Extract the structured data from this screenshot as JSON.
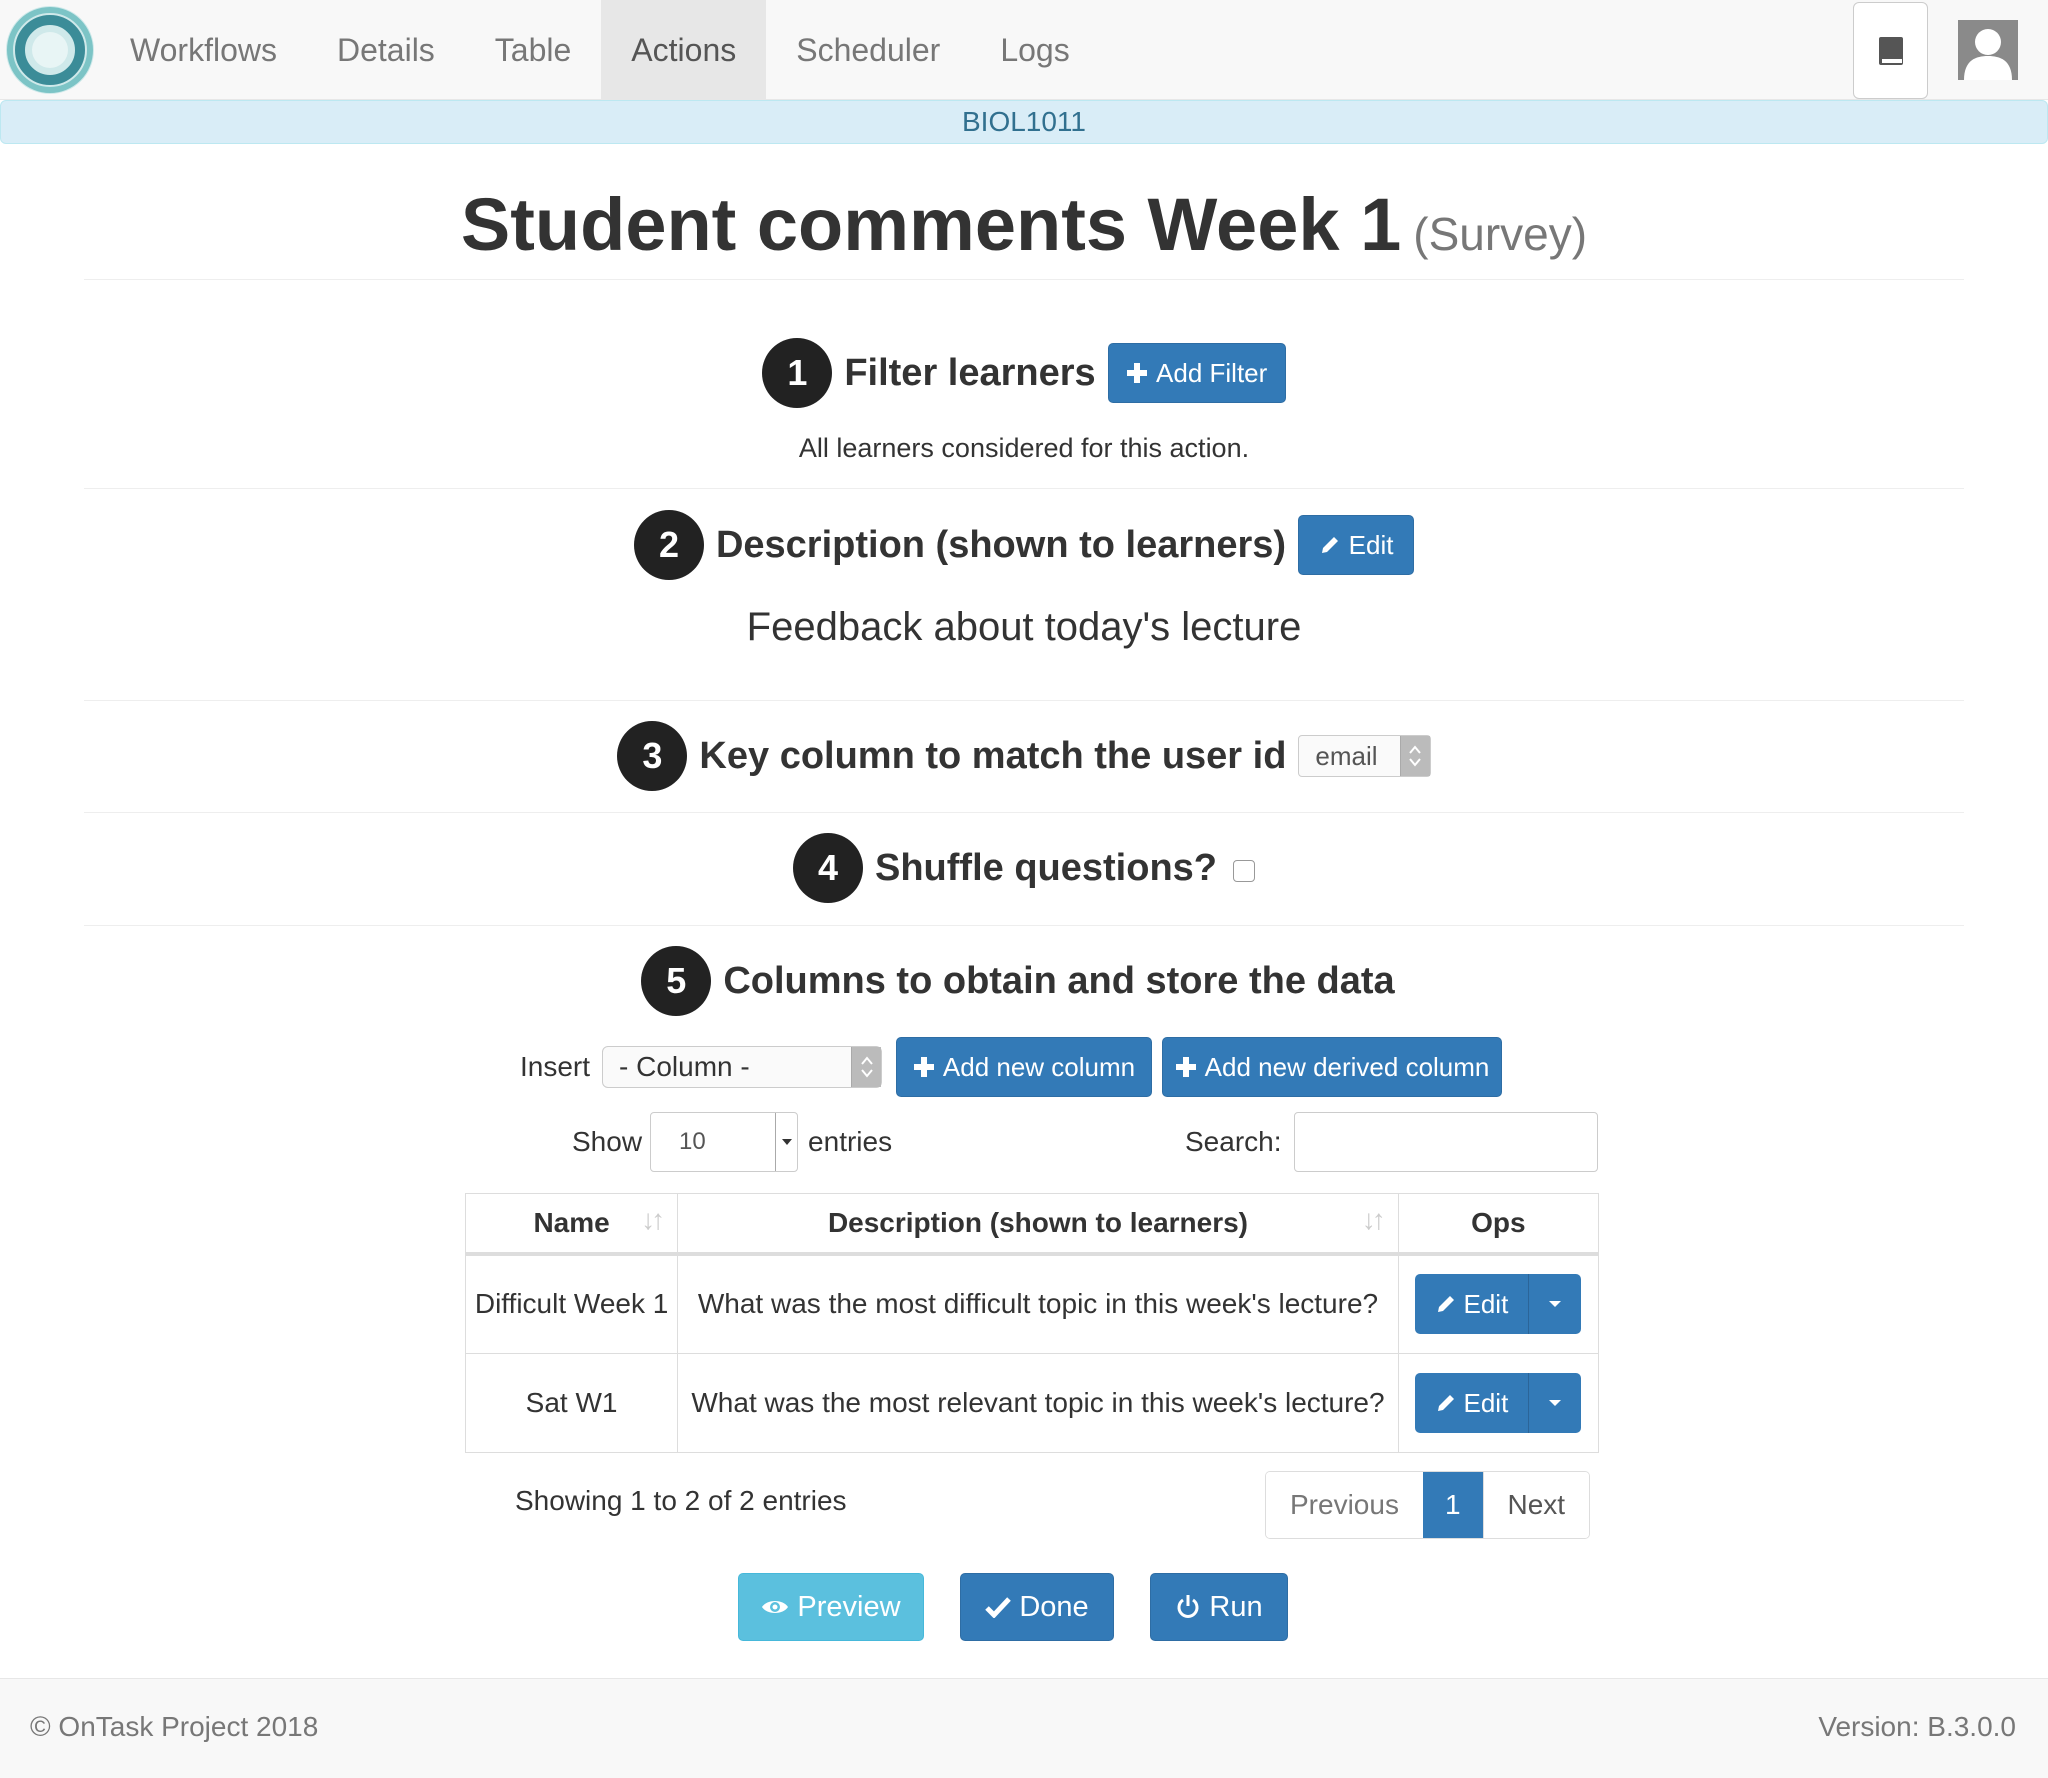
{
  "nav": {
    "tabs": [
      "Workflows",
      "Details",
      "Table",
      "Actions",
      "Scheduler",
      "Logs"
    ],
    "active_tab": "Actions"
  },
  "workflow_name": "BIOL1011",
  "page": {
    "title": "Student comments Week 1",
    "subtitle": "(Survey)"
  },
  "steps": {
    "filter": {
      "number": "1",
      "label": "Filter learners",
      "button": "Add Filter",
      "note": "All learners considered for this action."
    },
    "description": {
      "number": "2",
      "label": "Description (shown to learners)",
      "button": "Edit",
      "text": "Feedback about today's lecture"
    },
    "key": {
      "number": "3",
      "label": "Key column to match the user id",
      "selected": "email"
    },
    "shuffle": {
      "number": "4",
      "label": "Shuffle questions?",
      "checked": false
    },
    "columns": {
      "number": "5",
      "label": "Columns to obtain and store the data"
    }
  },
  "columns_tools": {
    "insert_label": "Insert",
    "insert_selected": "- Column -",
    "add_column": "Add new column",
    "add_derived": "Add new derived column",
    "show_label": "Show",
    "show_value": "10",
    "entries_label": "entries",
    "search_label": "Search:",
    "search_value": ""
  },
  "table": {
    "headers": {
      "name": "Name",
      "description": "Description (shown to learners)",
      "ops": "Ops"
    },
    "rows": [
      {
        "name": "Difficult Week 1",
        "description": "What was the most difficult topic in this week's lecture?",
        "op": "Edit"
      },
      {
        "name": "Sat W1",
        "description": "What was the most relevant topic in this week's lecture?",
        "op": "Edit"
      }
    ],
    "info": "Showing 1 to 2 of 2 entries",
    "pager": {
      "previous": "Previous",
      "current": "1",
      "next": "Next"
    }
  },
  "actions": {
    "preview": "Preview",
    "done": "Done",
    "run": "Run"
  },
  "footer": {
    "copyright": "© OnTask Project 2018",
    "version": "Version: B.3.0.0"
  },
  "colors": {
    "primary": "#337ab7",
    "info": "#5bc0de",
    "workflow_bar": "#d9edf7"
  },
  "icons": [
    "logo-icon",
    "book-icon",
    "user-avatar-icon",
    "plus-icon",
    "pencil-icon",
    "sort-icon",
    "caret-down-icon",
    "eye-icon",
    "check-icon",
    "power-icon"
  ]
}
